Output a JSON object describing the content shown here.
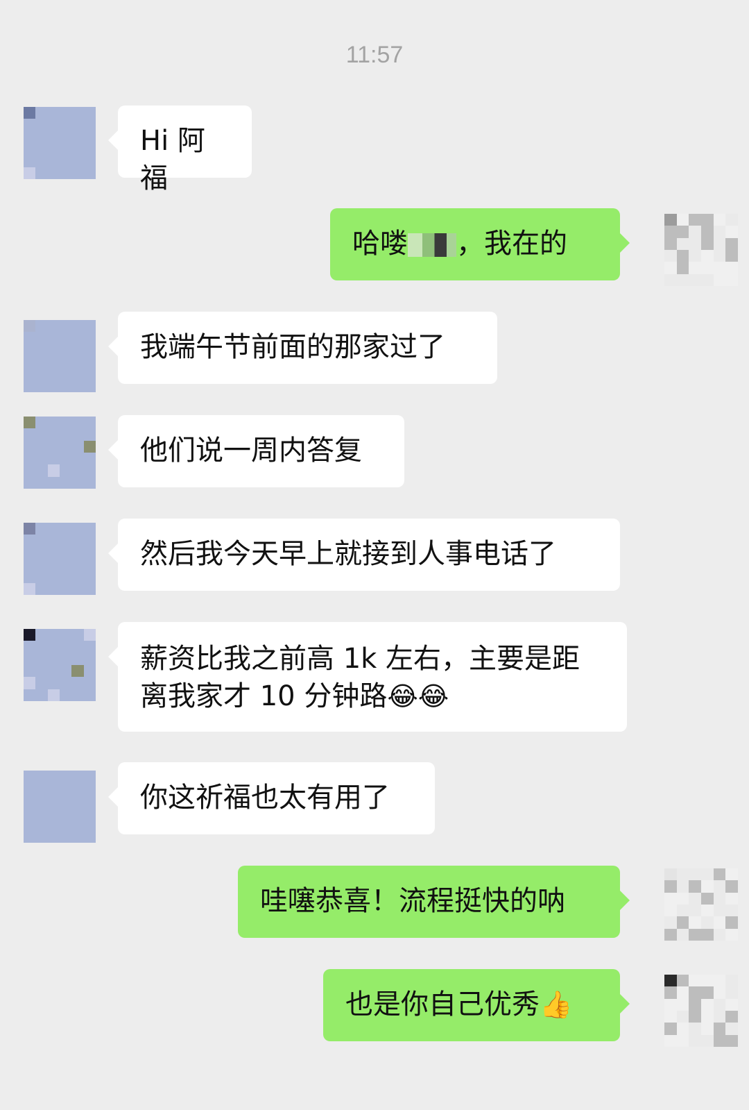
{
  "timestamp": "11:57",
  "messages": [
    {
      "dir": "in",
      "text": "Hi 阿福"
    },
    {
      "dir": "out",
      "text_before": "哈喽",
      "text_after": "，我在的"
    },
    {
      "dir": "in",
      "text": "我端午节前面的那家过了"
    },
    {
      "dir": "in",
      "text": "他们说一周内答复"
    },
    {
      "dir": "in",
      "text": "然后我今天早上就接到人事电话了"
    },
    {
      "dir": "in",
      "text": "薪资比我之前高 1k 左右，主要是距离我家才 10 分钟路",
      "emoji": "😂😂"
    },
    {
      "dir": "in",
      "text": "你这祈福也太有用了"
    },
    {
      "dir": "out",
      "text": "哇噻恭喜！流程挺快的呐"
    },
    {
      "dir": "out",
      "text": "也是你自己优秀",
      "emoji": "👍"
    }
  ],
  "colors": {
    "background": "#ededed",
    "incoming": "#ffffff",
    "outgoing": "#95ec69",
    "timestamp": "#a3a3a3"
  }
}
